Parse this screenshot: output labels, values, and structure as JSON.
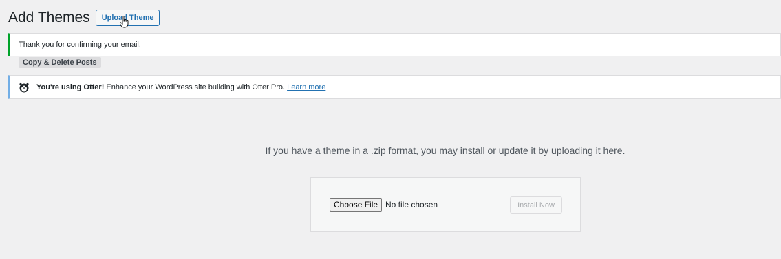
{
  "header": {
    "title": "Add Themes",
    "upload_button_label": "Upload Theme"
  },
  "notices": {
    "success_message": "Thank you for confirming your email.",
    "copy_delete_label": "Copy & Delete Posts",
    "otter_bold": "You're using Otter!",
    "otter_text": " Enhance your WordPress site building with Otter Pro.",
    "otter_link": "Learn more"
  },
  "upload": {
    "description": "If you have a theme in a .zip format, you may install or update it by uploading it here.",
    "choose_file_label": "Choose File",
    "file_status": "No file chosen",
    "install_label": "Install Now"
  },
  "colors": {
    "accent": "#2271b1",
    "success": "#00a32a",
    "info": "#72aee6"
  },
  "icons": {
    "otter": "otter-logo-icon",
    "cursor": "hand-pointer-icon"
  }
}
